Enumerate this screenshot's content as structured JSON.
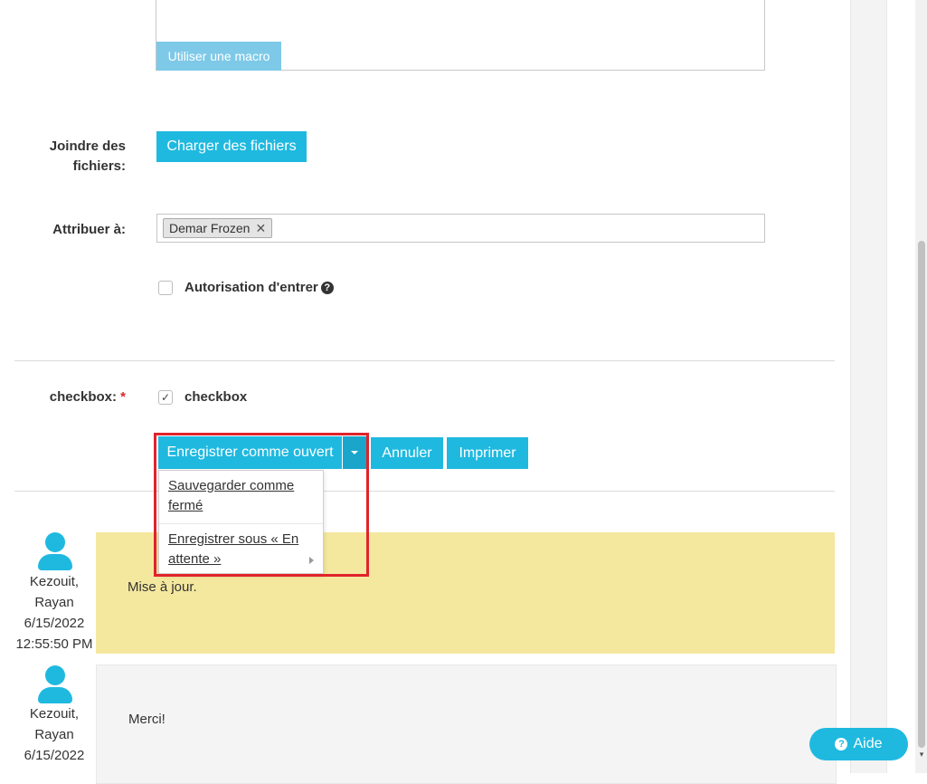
{
  "form": {
    "macro_button": "Utiliser une macro",
    "attach_label_line1": "Joindre des",
    "attach_label_line2": "fichiers:",
    "upload_button": "Charger des fichiers",
    "assign_label": "Attribuer à:",
    "assignee_tag": "Demar Frozen",
    "tag_remove": "✕",
    "permission_label": "Autorisation d'entrer",
    "help_glyph": "?",
    "checkbox_field_label": "checkbox:",
    "required_mark": "*",
    "checkbox_option_label": "checkbox",
    "checkbox_checked": true,
    "check_glyph": "✓"
  },
  "actions": {
    "save_open": "Enregistrer comme ouvert",
    "cancel": "Annuler",
    "print": "Imprimer",
    "dropdown": {
      "item1": "Sauvegarder comme fermé",
      "item2": "Enregistrer sous « En attente »"
    }
  },
  "comments": [
    {
      "author_line1": "Kezouit,",
      "author_line2": "Rayan",
      "date": "6/15/2022",
      "time": "12:55:50 PM",
      "text": "Mise à jour."
    },
    {
      "author_line1": "Kezouit,",
      "author_line2": "Rayan",
      "date": "6/15/2022",
      "text": "Merci!"
    }
  ],
  "help_button": {
    "label": "Aide",
    "icon_glyph": "?"
  },
  "colors": {
    "accent": "#1fb9e0",
    "highlight_border": "#e1232a",
    "comment_yellow": "#f4e89f"
  }
}
